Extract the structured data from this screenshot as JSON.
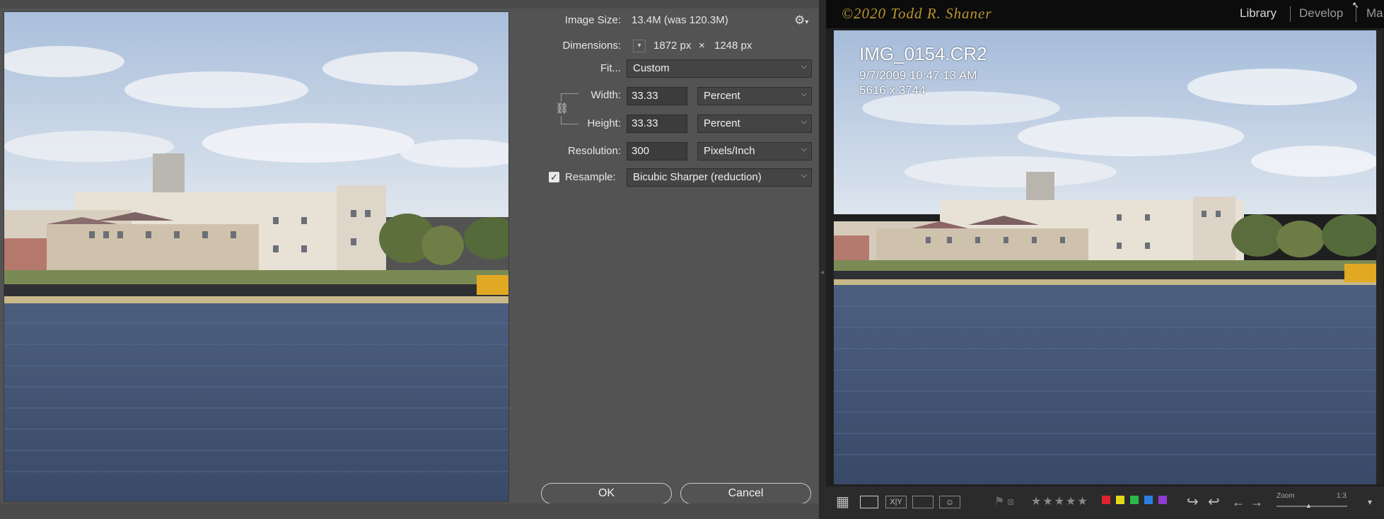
{
  "dialog": {
    "image_size_label": "Image Size:",
    "image_size_value": "13.4M (was 120.3M)",
    "dimensions_label": "Dimensions:",
    "dimensions_width": "1872 px",
    "dimensions_x": "×",
    "dimensions_height": "1248 px",
    "fit_label": "Fit...",
    "fit_value": "Custom",
    "width_label": "Width:",
    "width_value": "33.33",
    "width_unit": "Percent",
    "height_label": "Height:",
    "height_value": "33.33",
    "height_unit": "Percent",
    "resolution_label": "Resolution:",
    "resolution_value": "300",
    "resolution_unit": "Pixels/Inch",
    "resample_label": "Resample:",
    "resample_checked": true,
    "resample_value": "Bicubic Sharper (reduction)",
    "ok_label": "OK",
    "cancel_label": "Cancel"
  },
  "lightroom": {
    "identity_plate": "©2020 Todd R. Shaner",
    "modules": [
      "Library",
      "Develop",
      "Ma"
    ],
    "active_module": "Library",
    "photo_info": {
      "filename": "IMG_0154.CR2",
      "datetime": "9/7/2009 10:47:13 AM",
      "dimensions": "5616 x 3744"
    },
    "toolbar": {
      "zoom_label": "Zoom",
      "zoom_value": "1:3",
      "color_labels": [
        "#e0242f",
        "#e4d81c",
        "#2db84b",
        "#2a7fe0",
        "#8e3bd0"
      ]
    }
  },
  "icons": [
    "gear-icon",
    "chevron-down-icon",
    "link-icon",
    "check-icon",
    "grid-view-icon",
    "loupe-view-icon",
    "compare-view-icon",
    "survey-view-icon",
    "people-view-icon",
    "flag-icon",
    "reject-flag-icon",
    "star-icon",
    "rotate-left-icon",
    "rotate-right-icon",
    "arrow-left-icon",
    "arrow-right-icon"
  ]
}
